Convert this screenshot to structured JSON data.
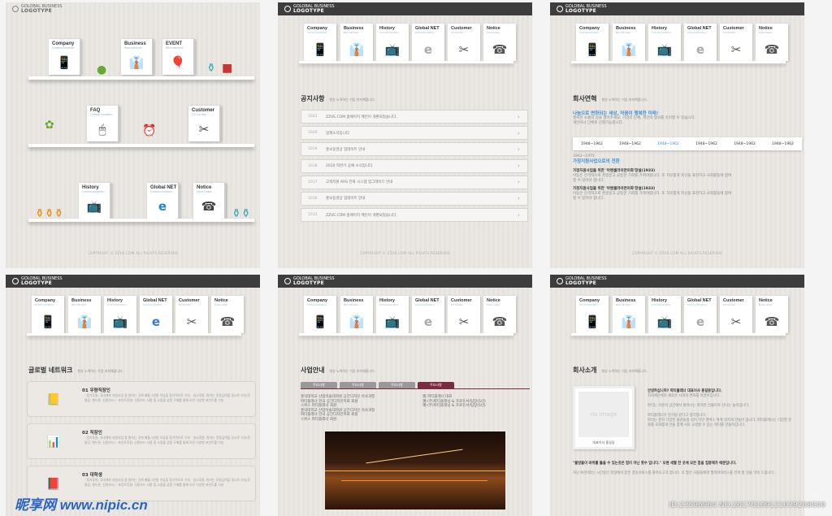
{
  "logo": {
    "line1": "GOLOBAL BUSINESS",
    "line2": "LOGOTYPE"
  },
  "copyright": "COPYRIGHT © ZZVE.COM ALL RIGHTS RESERVED",
  "menu": [
    {
      "label": "Company",
      "sub": "Communication",
      "icon": "phone-icon",
      "glyph": "📱"
    },
    {
      "label": "Business",
      "sub": "Recruitment",
      "icon": "suit-icon",
      "glyph": "👔"
    },
    {
      "label": "History",
      "sub": "Communication",
      "icon": "tv-icon",
      "glyph": "📺"
    },
    {
      "label": "Global NET",
      "sub": "Communication",
      "icon": "ie-icon",
      "glyph": "e"
    },
    {
      "label": "Customer",
      "sub": "CS Center",
      "icon": "tools-icon",
      "glyph": "✂"
    },
    {
      "label": "Notice",
      "sub": "Love news",
      "icon": "telephone-icon",
      "glyph": "☎"
    }
  ],
  "home": {
    "boxes": [
      {
        "label": "Company",
        "sub": "Communication",
        "glyph": "📱",
        "icon": "phone-icon"
      },
      {
        "label": "Business",
        "sub": "Recruitment",
        "glyph": "👔",
        "icon": "suit-icon"
      },
      {
        "label": "EVENT",
        "sub": "Recruitment",
        "glyph": "🎈",
        "icon": "balloon-icon"
      },
      {
        "label": "FAQ",
        "sub": "Communication",
        "glyph": "🖱",
        "icon": "mouse-icon"
      },
      {
        "label": "Customer",
        "sub": "CS Center",
        "glyph": "✂",
        "icon": "tools-icon"
      },
      {
        "label": "History",
        "sub": "Communication",
        "glyph": "📺",
        "icon": "tv-icon"
      },
      {
        "label": "Global NET",
        "sub": "Communication",
        "glyph": "e",
        "icon": "ie-icon"
      },
      {
        "label": "Notice",
        "sub": "Love news",
        "glyph": "☎",
        "icon": "telephone-icon"
      }
    ]
  },
  "notice": {
    "title": "공지사항",
    "tagline": "항상 노력하는 기업 지지해줍니다.",
    "rows": [
      {
        "num": "1021",
        "text": "ZZVE.COM 홈페이지 메인이 개편되었습니다."
      },
      {
        "num": "1020",
        "text": "업계소식입니다"
      },
      {
        "num": "1019",
        "text": "홍보동영상 업데이트 안내"
      },
      {
        "num": "1018",
        "text": "2010 하반기 공채 소식입니다."
      },
      {
        "num": "1017",
        "text": "고객지원 ARS 전화 시스템 업그레이드 안내"
      },
      {
        "num": "1016",
        "text": "홍보동영상 업데이트 안내"
      },
      {
        "num": "1015",
        "text": "ZZVE.COM 홈페이지 메인이 개편되었습니다."
      }
    ]
  },
  "history": {
    "title": "회사연혁",
    "tagline": "항상 노력하는 기업 지지해줍니다.",
    "headline": "나눔으로 변화되는 세상, 마음이 행복한 미래!",
    "intro1": "행복한 소통의 장을 열어주세요. 기업의 단체, 개인의 행사를 유지할 수 있습니다.",
    "intro2": "개인이나 단체로 신청가능합니다.",
    "years": [
      "1948~1962",
      "1948~1962",
      "1948~1962",
      "1948~1962",
      "1948~1962",
      "1948~1962"
    ],
    "period": "1963~1975",
    "period_title": "가정지원사업으로의 전환",
    "s1_title": "가정지원사업을 위한 '아렌셀러이면이화'창설(1933)",
    "s1_body": "아동은 인격적으로 존중받고 균등한 기회를 가져야합니다. 또 자유롭게 자신을 표현하고 사회활동에 참여 할 수 있어야 합니다.",
    "s2_title": "가정지원사업을 위한 '아렌셀러이면이화'창설(1933)",
    "s2_body": "아동은 인격적으로 존중받고 균등한 기회를 가져야합니다. 또 자유롭게 자신을 표현하고 사회활동에 참여 할 수 있어야 합니다."
  },
  "network": {
    "title": "글로벌 네트워크",
    "tagline": "항상 노력하는 기업 지지해줍니다.",
    "items": [
      {
        "title": "01 우량직장인",
        "icon": "notebook-icon",
        "glyph": "📒",
        "desc": "· 정기후원: 국내계좌 지원사업 중 원하는 곳에 매월 1만원 이상을 정기적으로 기부 · 일시후원: 원하는 후원금액을 일시로 기부(후통장, 핸드폰, 신용카드) · 포인트후원: 신용카드 사용 및 소핑몰 상품 구매를 통해 모은 다양한 포인트를 기부"
      },
      {
        "title": "02 직장인",
        "icon": "chart-icon",
        "glyph": "📊",
        "desc": "· 정기후원: 국내계좌 지원사업 중 원하는 곳에 매월 1만원 이상을 정기적으로 기부 · 일시후원: 원하는 후원금액을 일시로 기부(후통장, 핸드폰, 신용카드) · 포인트후원: 신용카드 사용 및 소핑몰 상품 구매를 통해 모은 다양한 포인트를 기부"
      },
      {
        "title": "03 대학생",
        "icon": "book-icon",
        "glyph": "📕",
        "desc": "· 정기후원: 국내계좌 지원사업 중 원하는 곳에 매월 1만원 이상을 정기적으로 기부 · 일시후원: 원하는 후원금액을 일시로 기부(후통장, 핸드폰, 신용카드) · 포인트후원: 신용카드 사용 및 소핑몰 상품 구매를 통해 모은 다양한 포인트를 기부"
      }
    ]
  },
  "business": {
    "title": "사업안내",
    "tagline": "항상 노력하는 기업 지지해줍니다.",
    "tabs": [
      "주요사항",
      "주요사항",
      "주요사항",
      "주요사항"
    ],
    "col1": [
      "홍익대학교 산업미술대학원 공간디자인 석사과정",
      "파티플래너 한국 공간디자인학회 회원",
      "홍익대학교 산업미술대학원 공간디자인 석사과정",
      "파티플래너 한국 공간디자인학회 회원",
      "스위스 파티플래너 회원",
      "스위스 파티플래너 회원"
    ],
    "col2": [
      "现-파티플래너 대표",
      "現-(주)파티플래닝 & 프로듀서/팀장(5년)",
      "現-(주)파티플래닝 & 프로듀서/팀장(5년)"
    ]
  },
  "intro": {
    "title": "회사소개",
    "tagline": "항상 노력하는 기업 지지해줍니다.",
    "noimage": "no image",
    "caption": "대표이사 홍길동",
    "greet": "안녕하십니까? 파티플래너 대표이사 홍길동입니다.",
    "greet2": "지자체단체의 새로운 시대의 변화를 이끌어갑니다.",
    "p1": "파티는 자유의 공간에서 벗어나는 화려한 전율이자 신나는 놀이입니다.",
    "p2": "파티플래너가 된거랑 같다고 생각합니다.",
    "p3": "파티는 뭔지 다양한 물감들을 섞어 하얀 캔버스 위에 멋지게 만들어 냅니다. 파티플래너는 다양한 문화를 조화롭게 만들 함께 서로 교감할 수 있는 파티를 만들어갑니다.",
    "quote": "\"물방울이 바위를 뚫을 수 있는것은 힘이 아닌 횟수 입니다.\" 오랜 세월 한 곳에 모든 힘을 집중해가 때문입니다.",
    "p4": "지난 9년이라는 시간동안 현장에서 받은 감동서비스를 맡아오고자 합니다. 더 많은 사람들에게 행복바이러스를 전파 할 것을 약속 드립니다."
  },
  "watermark": "昵享网 www.nipic.cn",
  "watermark2": "ID:23596964 NO:20170109121039208000"
}
